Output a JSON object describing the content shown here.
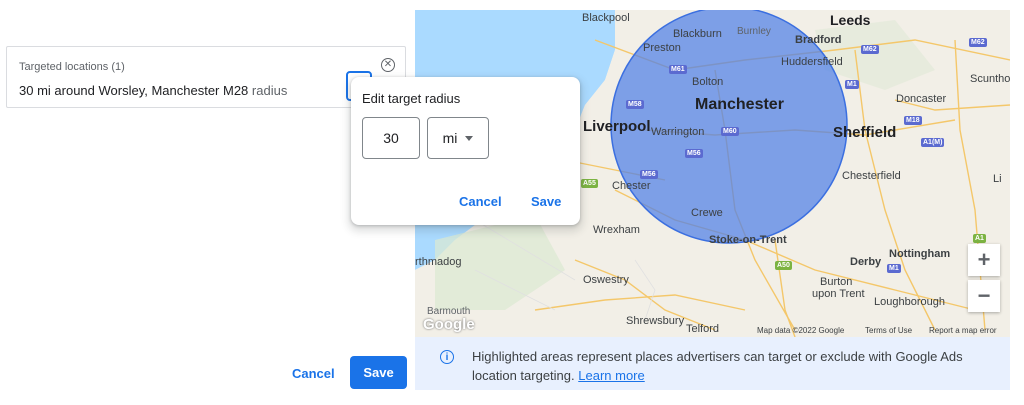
{
  "location_card": {
    "title": "Targeted locations (1)",
    "value": "30 mi around Worsley, Manchester M28",
    "suffix": "radius",
    "close_icon": "close-circle-icon"
  },
  "popup": {
    "title": "Edit target radius",
    "radius_value": "30",
    "unit": "mi",
    "cancel_label": "Cancel",
    "save_label": "Save"
  },
  "footer": {
    "cancel_label": "Cancel",
    "save_label": "Save"
  },
  "map": {
    "places": {
      "blackpool": "Blackpool",
      "leeds": "Leeds",
      "preston": "Preston",
      "blackburn": "Blackburn",
      "burnley": "Burnley",
      "bradford": "Bradford",
      "huddersfield": "Huddersfield",
      "bolton": "Bolton",
      "manchester": "Manchester",
      "liverpool": "Liverpool",
      "warrington": "Warrington",
      "sheffield": "Sheffield",
      "doncaster": "Doncaster",
      "scunthorpe": "Scuntho",
      "chester": "Chester",
      "chesterfield": "Chesterfield",
      "crewe": "Crewe",
      "wrexham": "Wrexham",
      "stoke": "Stoke-on-Trent",
      "nottingham": "Nottingham",
      "derby": "Derby",
      "burton": "Burton",
      "burton2": "upon Trent",
      "loughborough": "Loughborough",
      "oswestry": "Oswestry",
      "shrewsbury": "Shrewsbury",
      "telford": "Telford",
      "porthmadog": "rthmadog",
      "barmouth": "Barmouth",
      "lincoln": "Li"
    },
    "roads": {
      "m61": "M61",
      "m62a": "M62",
      "m62b": "M62",
      "m1": "M1",
      "m58": "M58",
      "m60": "M60",
      "m56a": "M56",
      "m56b": "M56",
      "m18": "M18",
      "a1m": "A1(M)",
      "a1": "A1",
      "m1b": "M1",
      "a50": "A50",
      "a55": "A55"
    },
    "zoom_in": "+",
    "zoom_out": "−",
    "attribution": "Map data ©2022 Google",
    "terms": "Terms of Use",
    "report": "Report a map error",
    "logo": "Google",
    "radius_circle_color": "#4f7fe8"
  },
  "info_banner": {
    "icon": "info-icon",
    "text": "Highlighted areas represent places advertisers can target or exclude with Google Ads location targeting.",
    "link": "Learn more"
  }
}
